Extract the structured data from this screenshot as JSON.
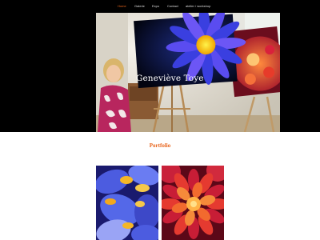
{
  "nav": {
    "items": [
      {
        "label": "Home",
        "active": true
      },
      {
        "label": "Galerie",
        "active": false
      },
      {
        "label": "Expo",
        "active": false
      },
      {
        "label": "Contact",
        "active": false
      },
      {
        "label": "atelier / workshop",
        "active": false
      }
    ]
  },
  "hero": {
    "title": "Geneviève Toye"
  },
  "portfolio": {
    "heading": "Portfolio",
    "items": [
      {
        "subject": "iris-painting"
      },
      {
        "subject": "dahlia-painting"
      }
    ]
  },
  "colors": {
    "accent": "#e8641b",
    "hero_background": "#000000",
    "page_background": "#ffffff"
  }
}
